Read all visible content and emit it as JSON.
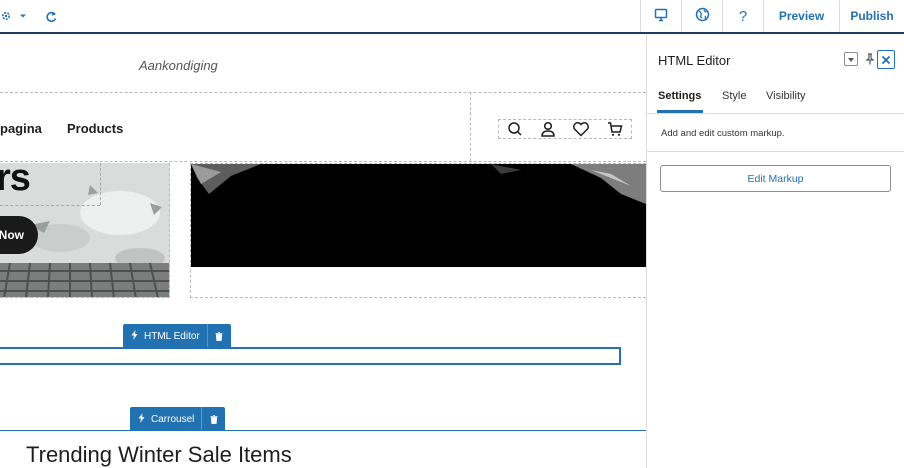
{
  "toolbar": {
    "left_icons": [
      "settings-icon",
      "chevron-down-icon",
      "redo-icon"
    ],
    "right_icons": [
      "desktop-icon",
      "globe-icon"
    ],
    "help_label": "?",
    "preview_label": "Preview",
    "publish_label": "Publish",
    "accent": "#2271b1"
  },
  "canvas": {
    "announcement": "Aankondiging",
    "nav": {
      "links": [
        "pagina",
        "Products"
      ]
    },
    "nav_icons": [
      "search-icon",
      "user-icon",
      "heart-icon",
      "cart-icon"
    ],
    "hero": {
      "title_fragment": "rs",
      "button_fragment": "Now"
    },
    "html_editor_badge": "HTML Editor",
    "carousel_badge": "Carrousel",
    "carousel_title": "Trending Winter Sale Items"
  },
  "panel": {
    "title": "HTML Editor",
    "tabs": [
      "Settings",
      "Style",
      "Visibility"
    ],
    "active_tab": "Settings",
    "help_text": "Add and edit custom markup.",
    "edit_button": "Edit Markup"
  }
}
